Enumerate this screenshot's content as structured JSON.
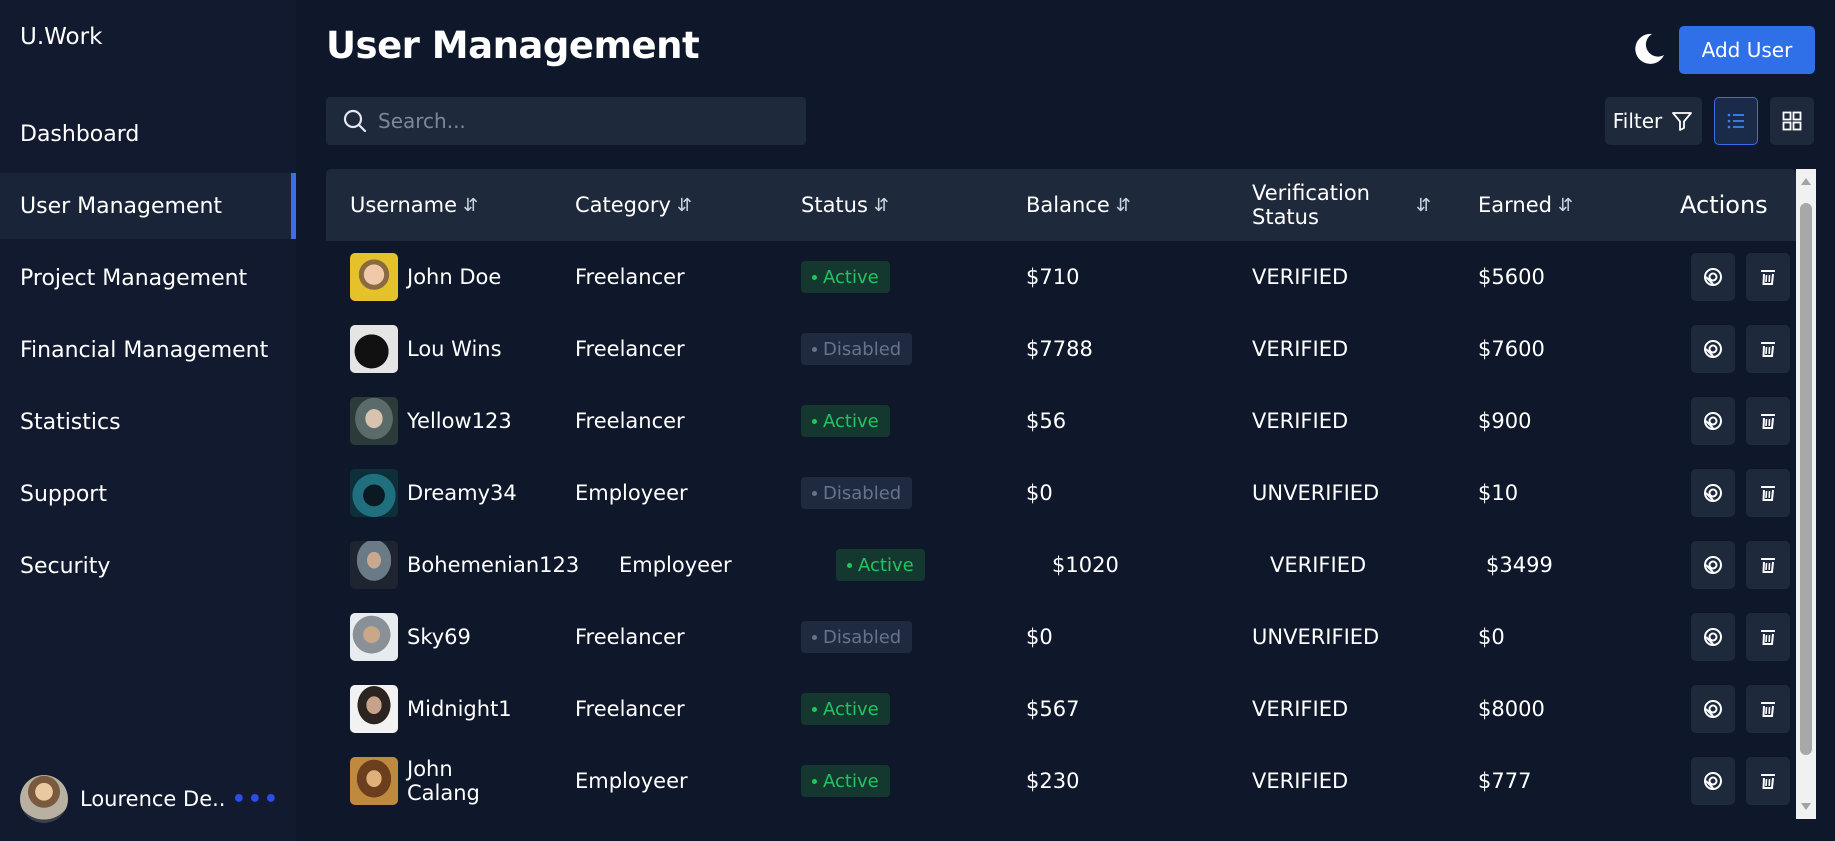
{
  "brand": "U.Work",
  "nav": [
    {
      "label": "Dashboard"
    },
    {
      "label": "User Management",
      "active": true
    },
    {
      "label": "Project Management"
    },
    {
      "label": "Financial Management"
    },
    {
      "label": "Statistics"
    },
    {
      "label": "Support"
    },
    {
      "label": "Security"
    }
  ],
  "profile": {
    "name": "Lourence De...",
    "more": "•••"
  },
  "header": {
    "title": "User Management",
    "add_user_label": "Add User",
    "theme_icon": "moon-icon"
  },
  "search": {
    "placeholder": "Search...",
    "value": ""
  },
  "toolbar": {
    "filter_label": "Filter",
    "view_mode": "list"
  },
  "table": {
    "columns": [
      "Username",
      "Category",
      "Status",
      "Balance",
      "Verification Status",
      "Earned",
      "Actions"
    ],
    "rows": [
      {
        "username": "John Doe",
        "category": "Freelancer",
        "status": "Active",
        "balance": "$710",
        "verification": "VERIFIED",
        "earned": "$5600"
      },
      {
        "username": "Lou Wins",
        "category": "Freelancer",
        "status": "Disabled",
        "balance": "$7788",
        "verification": "VERIFIED",
        "earned": "$7600"
      },
      {
        "username": "Yellow123",
        "category": "Freelancer",
        "status": "Active",
        "balance": "$56",
        "verification": "VERIFIED",
        "earned": "$900"
      },
      {
        "username": "Dreamy34",
        "category": "Employeer",
        "status": "Disabled",
        "balance": "$0",
        "verification": "UNVERIFIED",
        "earned": "$10"
      },
      {
        "username": "Bohemenian123",
        "category": "Employeer",
        "status": "Active",
        "balance": "$1020",
        "verification": "VERIFIED",
        "earned": "$3499"
      },
      {
        "username": "Sky69",
        "category": "Freelancer",
        "status": "Disabled",
        "balance": "$0",
        "verification": "UNVERIFIED",
        "earned": "$0"
      },
      {
        "username": "Midnight1",
        "category": "Freelancer",
        "status": "Active",
        "balance": "$567",
        "verification": "VERIFIED",
        "earned": "$8000"
      },
      {
        "username": "John Calang",
        "category": "Employeer",
        "status": "Active",
        "balance": "$230",
        "verification": "VERIFIED",
        "earned": "$777"
      }
    ]
  },
  "colors": {
    "background": "#0f172a",
    "sidebar": "#111a2e",
    "accent": "#2f6fe8",
    "active_badge": "#22c55e",
    "disabled_badge": "#64748b"
  }
}
